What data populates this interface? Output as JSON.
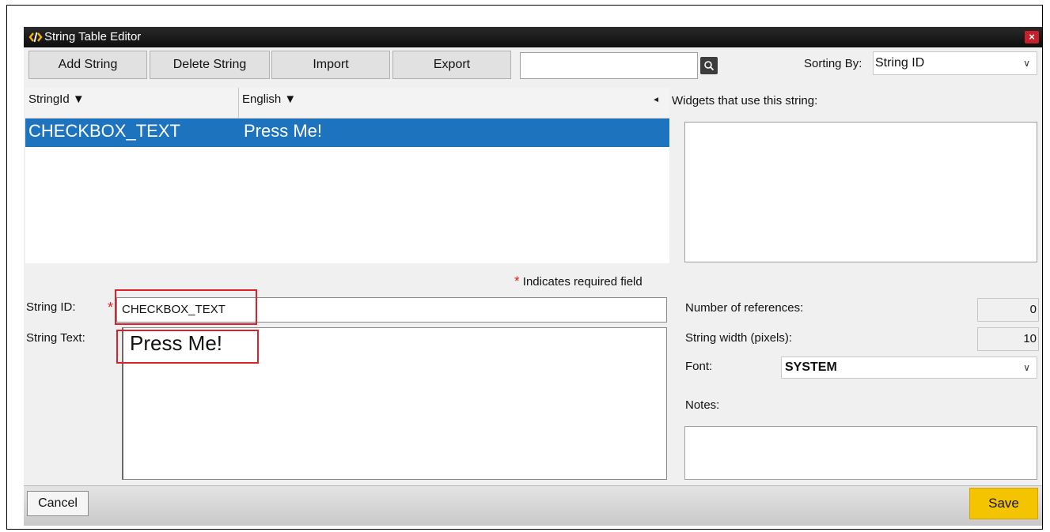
{
  "window": {
    "title": "String Table Editor",
    "close_glyph": "×"
  },
  "toolbar": {
    "add_label": "Add String",
    "delete_label": "Delete String",
    "import_label": "Import",
    "export_label": "Export",
    "search_value": "",
    "sort_label": "Sorting By:",
    "sort_value": "String ID"
  },
  "table": {
    "columns": [
      "StringId ▼",
      "English ▼"
    ],
    "scroll_arrow": "◄",
    "rows": [
      {
        "id": "CHECKBOX_TEXT",
        "english": "Press Me!"
      }
    ]
  },
  "widgets": {
    "label": "Widgets that use this string:"
  },
  "form": {
    "required_note": "Indicates required field",
    "required_star": "*",
    "string_id_label": "String ID:",
    "string_id_value": "CHECKBOX_TEXT",
    "string_text_label": "String Text:",
    "string_text_value": "Press Me!"
  },
  "details": {
    "refs_label": "Number of references:",
    "refs_value": "0",
    "width_label": "String width (pixels):",
    "width_value": "10",
    "font_label": "Font:",
    "font_value": "SYSTEM",
    "notes_label": "Notes:"
  },
  "footer": {
    "cancel_label": "Cancel",
    "save_label": "Save"
  },
  "colors": {
    "selection": "#1e73be",
    "save": "#f5c400",
    "highlight": "#d9222a",
    "titlebar": "#1a1a1a"
  },
  "icons": {
    "title": "code-icon",
    "search": "search-icon",
    "close": "close-icon",
    "dropdown": "chevron-down-icon"
  }
}
